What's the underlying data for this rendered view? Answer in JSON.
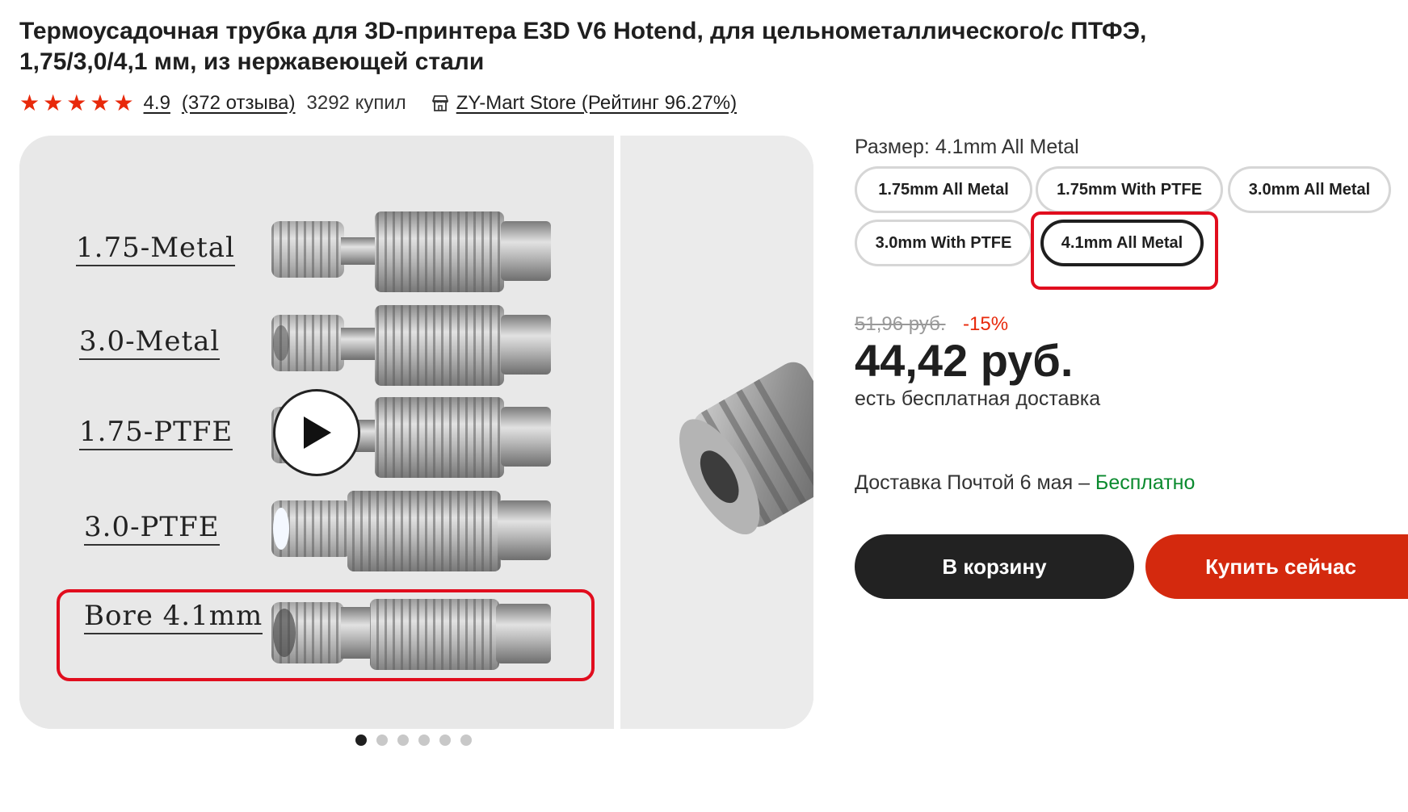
{
  "product": {
    "title_line1": "Термоусадочная трубка для 3D-принтера E3D V6 Hotend, для цельнометаллического/с ПТФЭ,",
    "title_line2": "1,75/3,0/4,1 мм, из нержавеющей стали",
    "rating": "4.9",
    "reviews": "(372 отзыва)",
    "sold": "3292 купил",
    "store": "ZY-Mart Store (Рейтинг 96.27%)",
    "star_count": 5
  },
  "gallery": {
    "labels": [
      "1.75-Metal",
      "3.0-Metal",
      "1.75-PTFE",
      "3.0-PTFE",
      "Bore 4.1mm"
    ],
    "dot_count": 6,
    "active_dot": 0
  },
  "size": {
    "label": "Размер: 4.1mm All Metal",
    "options": [
      "1.75mm All Metal",
      "1.75mm With PTFE",
      "3.0mm All Metal",
      "3.0mm With PTFE",
      "4.1mm All Metal"
    ],
    "selected": "4.1mm All Metal"
  },
  "pricing": {
    "old_price": "51,96 руб.",
    "discount": "-15%",
    "price": "44,42 руб.",
    "free_shipping": "есть бесплатная доставка"
  },
  "delivery": {
    "text": "Доставка Почтой 6 мая – ",
    "free": "Бесплатно"
  },
  "actions": {
    "cart": "В корзину",
    "buy": "Купить сейчас"
  },
  "colors": {
    "accent_red": "#d4290e",
    "star": "#e8290b",
    "free_green": "#0a8a2e",
    "highlight": "#e10d1e"
  }
}
